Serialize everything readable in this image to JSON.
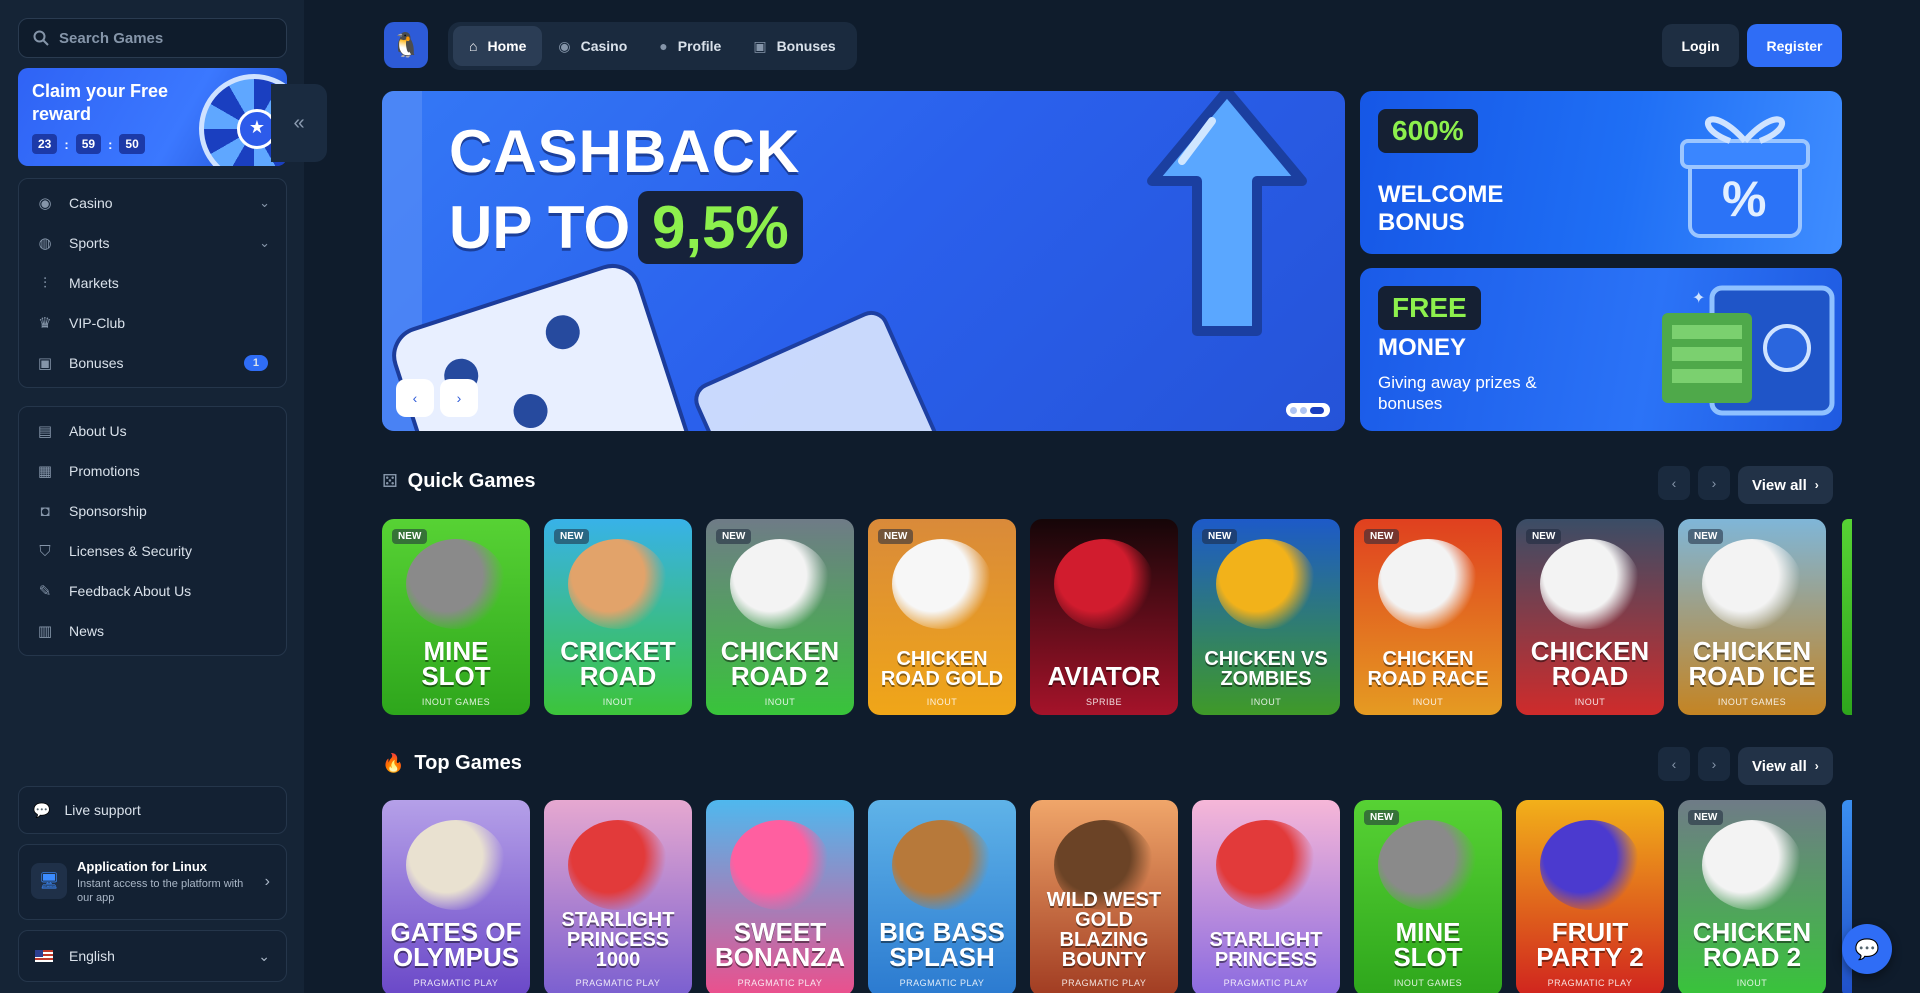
{
  "search": {
    "placeholder": "Search Games"
  },
  "reward": {
    "title": "Claim your Free reward",
    "timer": [
      "23",
      "59",
      "50"
    ]
  },
  "sidebar": {
    "menu": [
      {
        "label": "Casino",
        "icon": "casino-icon",
        "expandable": true
      },
      {
        "label": "Sports",
        "icon": "sports-icon",
        "expandable": true
      },
      {
        "label": "Markets",
        "icon": "markets-icon"
      },
      {
        "label": "VIP-Club",
        "icon": "crown-icon"
      },
      {
        "label": "Bonuses",
        "icon": "gift-icon",
        "badge": "1"
      }
    ],
    "info": [
      {
        "label": "About Us",
        "icon": "book-icon"
      },
      {
        "label": "Promotions",
        "icon": "promotions-icon"
      },
      {
        "label": "Sponsorship",
        "icon": "sponsorship-icon"
      },
      {
        "label": "Licenses & Security",
        "icon": "shield-icon"
      },
      {
        "label": "Feedback About Us",
        "icon": "feedback-icon"
      },
      {
        "label": "News",
        "icon": "news-icon"
      }
    ],
    "support": "Live support",
    "app": {
      "title": "Application for Linux",
      "subtitle": "Instant access to the platform with our app"
    },
    "language": "English"
  },
  "nav": {
    "items": [
      {
        "label": "Home",
        "active": true,
        "icon": "home-icon"
      },
      {
        "label": "Casino",
        "icon": "casino-icon"
      },
      {
        "label": "Profile",
        "icon": "user-icon"
      },
      {
        "label": "Bonuses",
        "icon": "gift-icon"
      }
    ],
    "login": "Login",
    "register": "Register"
  },
  "hero": {
    "line1": "CASHBACK",
    "line2": "UP TO",
    "percent": "9,5%"
  },
  "promo1": {
    "tag": "600%",
    "title": "WELCOME BONUS"
  },
  "promo2": {
    "tag": "FREE",
    "title": "MONEY",
    "subtitle": "Giving away prizes & bonuses"
  },
  "sections": {
    "quick": {
      "title": "Quick Games",
      "view_all": "View all"
    },
    "top": {
      "title": "Top Games",
      "view_all": "View all"
    }
  },
  "quick_games": [
    {
      "title": "MINE SLOT",
      "provider": "INOUT GAMES",
      "new": true,
      "bg": [
        "#57d234",
        "#2ea61c"
      ],
      "art": "#8a8a8a"
    },
    {
      "title": "CRICKET ROAD",
      "provider": "INOUT",
      "new": true,
      "bg": [
        "#38b2e8",
        "#3cc43a"
      ],
      "art": "#e2a36a"
    },
    {
      "title": "CHICKEN ROAD 2",
      "provider": "INOUT",
      "new": true,
      "bg": [
        "#6f7b87",
        "#38c43a"
      ],
      "art": "#f3f3f3"
    },
    {
      "title": "CHICKEN ROAD GOLD",
      "provider": "INOUT",
      "new": true,
      "bg": [
        "#d98a3a",
        "#f0a618"
      ],
      "art": "#f7f7f7"
    },
    {
      "title": "AVIATOR",
      "provider": "SPRIBE",
      "new": false,
      "bg": [
        "#150608",
        "#a5132a"
      ],
      "art": "#d11c2e"
    },
    {
      "title": "CHICKEN VS ZOMBIES",
      "provider": "INOUT",
      "new": true,
      "bg": [
        "#1d5ac8",
        "#3f9a28"
      ],
      "art": "#f2b21a"
    },
    {
      "title": "CHICKEN ROAD RACE",
      "provider": "INOUT",
      "new": true,
      "bg": [
        "#e0401f",
        "#e59b22"
      ],
      "art": "#f3f3f3"
    },
    {
      "title": "CHICKEN ROAD",
      "provider": "INOUT",
      "new": true,
      "bg": [
        "#3a4d66",
        "#cf2b2b"
      ],
      "art": "#f3f3f3"
    },
    {
      "title": "CHICKEN ROAD ICE",
      "provider": "INOUT GAMES",
      "new": true,
      "bg": [
        "#7fb6d8",
        "#c48423"
      ],
      "art": "#f3f3f3"
    }
  ],
  "top_games": [
    {
      "title": "GATES OF OLYMPUS",
      "provider": "PRAGMATIC PLAY",
      "new": false,
      "bg": [
        "#b5a0e8",
        "#6a48c8"
      ],
      "art": "#e9e1d0"
    },
    {
      "title": "STARLIGHT PRINCESS 1000",
      "provider": "PRAGMATIC PLAY",
      "new": false,
      "bg": [
        "#e6a8d0",
        "#7a5fd0"
      ],
      "art": "#e23a3a"
    },
    {
      "title": "SWEET BONANZA",
      "provider": "PRAGMATIC PLAY",
      "new": false,
      "bg": [
        "#4fb8ee",
        "#ec4f8c"
      ],
      "art": "#ff5fa0"
    },
    {
      "title": "BIG BASS SPLASH",
      "provider": "PRAGMATIC PLAY",
      "new": false,
      "bg": [
        "#5fb3e8",
        "#2b7ad0"
      ],
      "art": "#b7793a"
    },
    {
      "title": "WILD WEST GOLD BLAZING BOUNTY",
      "provider": "PRAGMATIC PLAY",
      "new": false,
      "bg": [
        "#f0a66a",
        "#a13c22"
      ],
      "art": "#6b4326"
    },
    {
      "title": "STARLIGHT PRINCESS",
      "provider": "PRAGMATIC PLAY",
      "new": false,
      "bg": [
        "#f6b7d8",
        "#8a6ae0"
      ],
      "art": "#e23a3a"
    },
    {
      "title": "MINE SLOT",
      "provider": "INOUT GAMES",
      "new": true,
      "bg": [
        "#57d234",
        "#2ea61c"
      ],
      "art": "#8a8a8a"
    },
    {
      "title": "FRUIT PARTY 2",
      "provider": "PRAGMATIC PLAY",
      "new": false,
      "bg": [
        "#f2b01a",
        "#d0241e"
      ],
      "art": "#4b3acf"
    },
    {
      "title": "CHICKEN ROAD 2",
      "provider": "INOUT",
      "new": true,
      "bg": [
        "#6f7b87",
        "#38c43a"
      ],
      "art": "#f3f3f3"
    }
  ],
  "colors": {
    "accent": "#2f6df6",
    "bonus_green": "#8df04d",
    "background": "#0f1c2c"
  }
}
